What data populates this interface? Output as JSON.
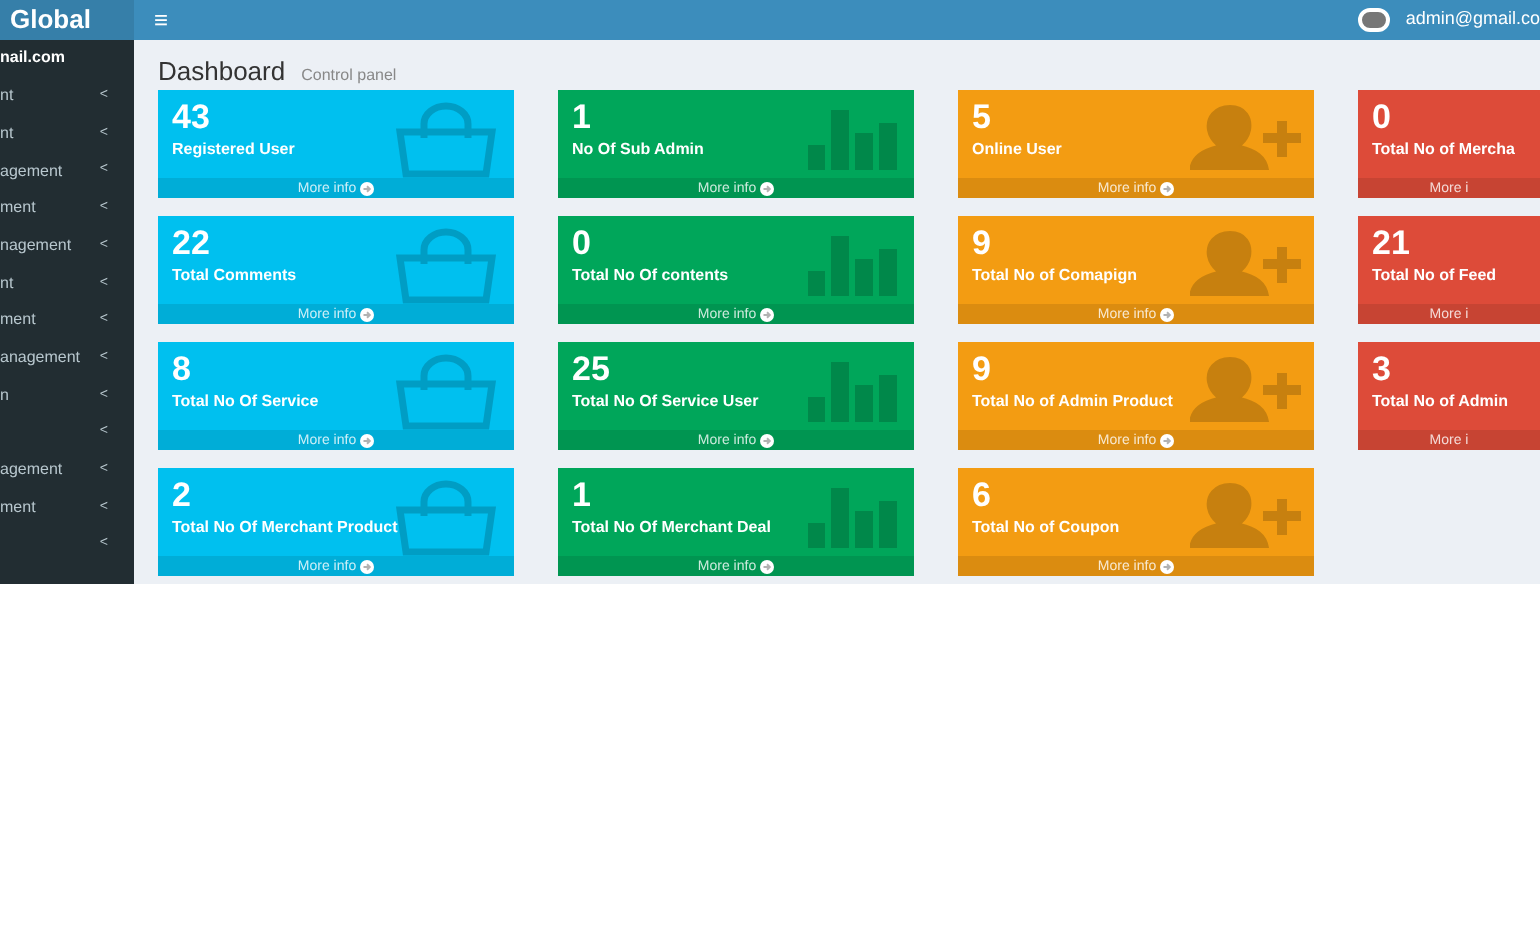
{
  "header": {
    "logo": "Global",
    "menu_icon": "≡",
    "user_email": "admin@gmail.co"
  },
  "sidebar": {
    "user_text": "nail.com",
    "items": [
      {
        "label": "nt",
        "arrow": "<"
      },
      {
        "label": "nt",
        "arrow": "<"
      },
      {
        "label": "agement",
        "arrow": "<"
      },
      {
        "label": "ment",
        "arrow": "<"
      },
      {
        "label": "nagement",
        "arrow": "<"
      },
      {
        "label": "nt",
        "arrow": "<"
      },
      {
        "label": "ment",
        "arrow": "<"
      },
      {
        "label": "anagement",
        "arrow": "<"
      },
      {
        "label": "n",
        "arrow": "<"
      },
      {
        "arrow": "<"
      },
      {
        "label": "agement",
        "arrow": "<"
      },
      {
        "label": "ment",
        "arrow": "<"
      },
      {
        "arrow": "<"
      }
    ]
  },
  "page": {
    "title": "Dashboard",
    "subtitle": "Control panel"
  },
  "cards": [
    {
      "value": "43",
      "label": "Registered User",
      "footer": "More info",
      "color": "#00c0ef",
      "kind": "bag"
    },
    {
      "value": "1",
      "label": "No Of Sub Admin",
      "footer": "More info",
      "color": "#00a65a",
      "kind": "bars"
    },
    {
      "value": "5",
      "label": "Online User",
      "footer": "More info",
      "color": "#f39c12",
      "kind": "user"
    },
    {
      "value": "0",
      "label": "Total No of Mercha",
      "footer": "More i",
      "color": "#dd4b39",
      "kind": "none"
    },
    {
      "value": "22",
      "label": "Total Comments",
      "footer": "More info",
      "color": "#00c0ef",
      "kind": "bag"
    },
    {
      "value": "0",
      "label": "Total No Of contents",
      "footer": "More info",
      "color": "#00a65a",
      "kind": "bars"
    },
    {
      "value": "9",
      "label": "Total No of Comapign",
      "footer": "More info",
      "color": "#f39c12",
      "kind": "user"
    },
    {
      "value": "21",
      "label": "Total No of Feed",
      "footer": "More i",
      "color": "#dd4b39",
      "kind": "none"
    },
    {
      "value": "8",
      "label": "Total No Of Service",
      "footer": "More info",
      "color": "#00c0ef",
      "kind": "bag"
    },
    {
      "value": "25",
      "label": "Total No Of Service User",
      "footer": "More info",
      "color": "#00a65a",
      "kind": "bars"
    },
    {
      "value": "9",
      "label": "Total No of Admin Product",
      "footer": "More info",
      "color": "#f39c12",
      "kind": "user"
    },
    {
      "value": "3",
      "label": "Total No of Admin",
      "footer": "More i",
      "color": "#dd4b39",
      "kind": "none"
    },
    {
      "value": "2",
      "label": "Total No Of Merchant Product",
      "footer": "More info",
      "color": "#00c0ef",
      "kind": "bag"
    },
    {
      "value": "1",
      "label": "Total No Of Merchant Deal",
      "footer": "More info",
      "color": "#00a65a",
      "kind": "bars"
    },
    {
      "value": "6",
      "label": "Total No of Coupon",
      "footer": "More info",
      "color": "#f39c12",
      "kind": "user"
    }
  ]
}
